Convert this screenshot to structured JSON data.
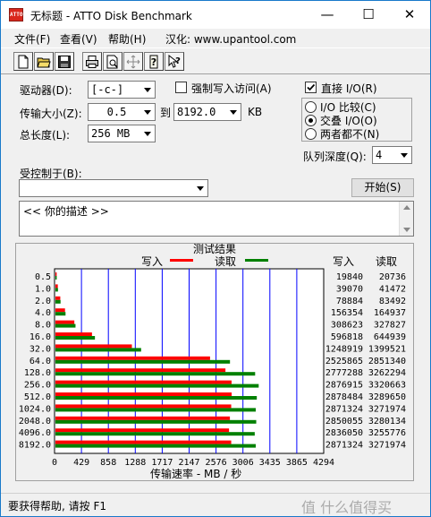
{
  "window": {
    "title": "无标题 - ATTO Disk Benchmark",
    "app_icon_text": "ATTO",
    "minimize_glyph": "—",
    "maximize_glyph": "☐",
    "close_glyph": "✕"
  },
  "menu": {
    "items": [
      "文件(F)",
      "查看(V)",
      "帮助(H)",
      "汉化: www.upantool.com"
    ]
  },
  "toolbar": {
    "icons": [
      "new-document-icon",
      "open-folder-icon",
      "save-icon",
      "print-icon",
      "print-preview-icon",
      "move-icon",
      "help-icon",
      "context-help-icon"
    ]
  },
  "settings": {
    "drive_label": "驱动器(D):",
    "drive_value": "[-c-]",
    "transfer_label": "传输大小(Z):",
    "transfer_from": "0.5",
    "transfer_to_label": "到",
    "transfer_to": "8192.0",
    "transfer_unit": "KB",
    "total_label": "总长度(L):",
    "total_value": "256 MB",
    "force_write_label": "强制写入访问(A)",
    "force_write_checked": false,
    "direct_io_label": "直接 I/O(R)",
    "direct_io_checked": true,
    "radio_options": [
      "I/O 比较(C)",
      "交叠 I/O(O)",
      "两者都不(N)"
    ],
    "radio_selected": 1,
    "queue_label": "队列深度(Q):",
    "queue_value": "4",
    "controlled_label": "受控制于(B):",
    "controlled_value": "",
    "start_button": "开始(S)",
    "description": "<<   你的描述   >>"
  },
  "results": {
    "title": "测试结果",
    "write_label": "写入",
    "read_label": "读取",
    "col_write": "写入",
    "col_read": "读取"
  },
  "status": {
    "text": "要获得帮助, 请按 F1",
    "watermark": "值 什么值得买"
  },
  "chart_data": {
    "type": "bar",
    "orientation": "horizontal",
    "categories": [
      "0.5",
      "1.0",
      "2.0",
      "4.0",
      "8.0",
      "16.0",
      "32.0",
      "64.0",
      "128.0",
      "256.0",
      "512.0",
      "1024.0",
      "2048.0",
      "4096.0",
      "8192.0"
    ],
    "series": [
      {
        "name": "写入",
        "color": "#ff0000",
        "values": [
          19840,
          39070,
          78884,
          156354,
          308623,
          596818,
          1248919,
          2525865,
          2777288,
          2876915,
          2878484,
          2871324,
          2850055,
          2836050,
          2871324
        ]
      },
      {
        "name": "读取",
        "color": "#008000",
        "values": [
          20736,
          41472,
          83492,
          164937,
          327827,
          644939,
          1399521,
          2851340,
          3262294,
          3320663,
          3289650,
          3271974,
          3280134,
          3255776,
          3271974
        ]
      }
    ],
    "xlabel": "传输速率 - MB / 秒",
    "xticks": [
      "0",
      "429",
      "858",
      "1288",
      "1717",
      "2147",
      "2576",
      "3006",
      "3435",
      "3865",
      "4294"
    ],
    "xlim": [
      0,
      4294
    ],
    "bar_value_unit": "KB/s",
    "grid": true,
    "legend": "top"
  },
  "colors": {
    "write": "#ff0000",
    "read": "#008000",
    "grid": "#0000ff"
  }
}
